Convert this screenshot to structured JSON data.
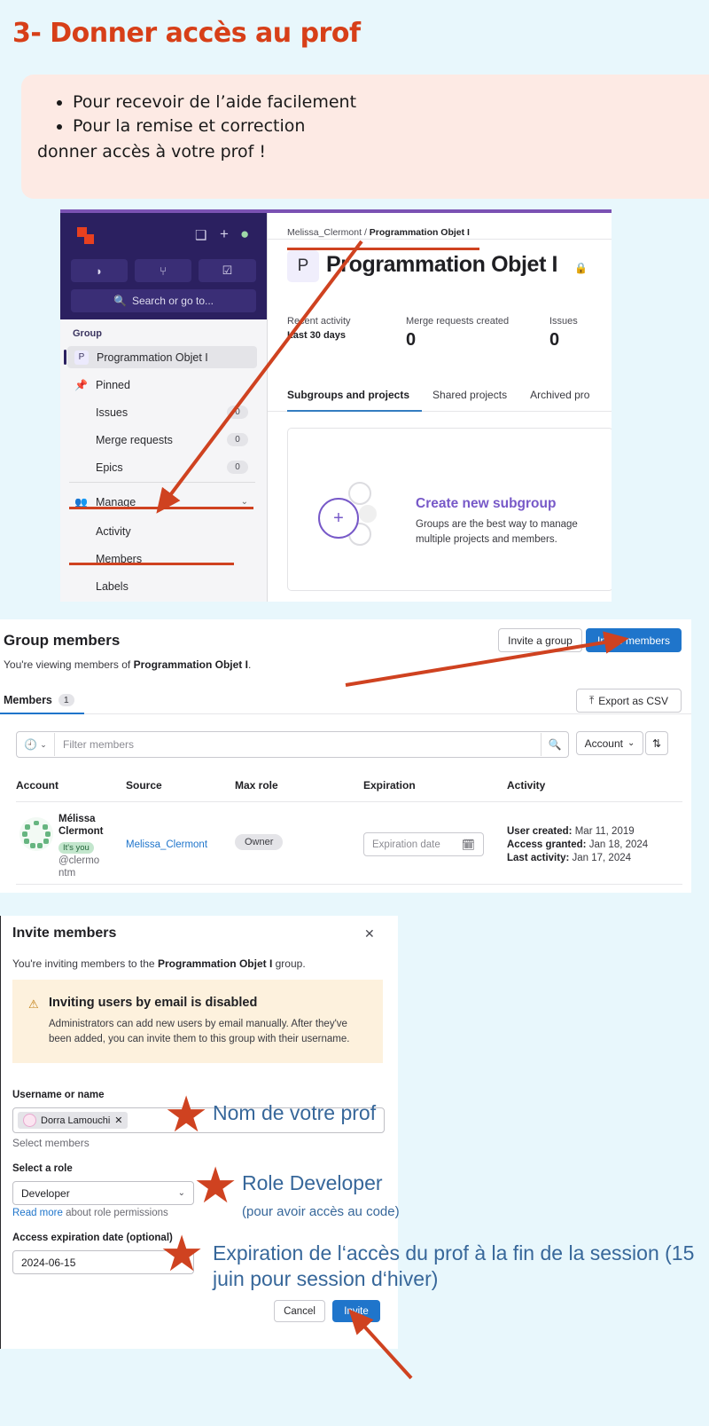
{
  "slide": {
    "title": "3- Donner accès au prof",
    "bullets": [
      "Pour recevoir de l’aide facilement",
      "Pour la remise et correction"
    ],
    "tail": "donner accès à votre prof !"
  },
  "colors": {
    "page_bg": "#e8f7fc",
    "title_orange": "#d73f18",
    "card_pink": "#fdeae4",
    "annotation_blue": "#37679a",
    "arrow_red": "#cf4220",
    "gitlab_purple": "#2b2060",
    "link_blue": "#1f75cb"
  },
  "gitlab_group_page": {
    "nav": {
      "logo": "gitlab-logo-icon",
      "top_icons": [
        "sidebar-toggle-icon",
        "plus-icon",
        "avatar-icon"
      ],
      "quick_buttons": [
        "issues-icon",
        "merge-request-icon",
        "todo-icon"
      ],
      "search_placeholder": "Search or go to...",
      "section_label": "Group",
      "items": [
        {
          "label": "Programmation Objet I",
          "badge": "P",
          "selected": true
        },
        {
          "label": "Pinned",
          "icon": "pin-icon"
        },
        {
          "label": "Issues",
          "count": "0"
        },
        {
          "label": "Merge requests",
          "count": "0"
        },
        {
          "label": "Epics",
          "count": "0"
        },
        {
          "label": "Manage",
          "icon": "users-icon",
          "chevron": "⌄"
        },
        {
          "label": "Activity"
        },
        {
          "label": "Members"
        },
        {
          "label": "Labels"
        }
      ]
    },
    "breadcrumb": {
      "owner": "Melissa_Clermont",
      "sep": "/",
      "current": "Programmation Objet I"
    },
    "project_badge": "P",
    "project_title": "Programmation Objet I",
    "lock_icon": "lock-icon",
    "stats": [
      {
        "label": "Recent activity",
        "value": "Last 30 days"
      },
      {
        "label": "Merge requests created",
        "value": "0"
      },
      {
        "label": "Issues",
        "value": "0"
      }
    ],
    "tabs": [
      "Subgroups and projects",
      "Shared projects",
      "Archived pro"
    ],
    "subgroup_card": {
      "title": "Create new subgroup",
      "description": "Groups are the best way to manage multiple projects and members.",
      "plus": "+"
    }
  },
  "group_members_page": {
    "title": "Group members",
    "subtitle_prefix": "You're viewing members of ",
    "subtitle_bold": "Programmation Objet I",
    "subtitle_suffix": ".",
    "invite_group_label": "Invite a group",
    "invite_members_label": "Invite members",
    "members_tab_label": "Members",
    "members_tab_count": "1",
    "export_label": "Export as CSV",
    "export_icon": "upload-icon",
    "filter": {
      "history_icon": "history-icon",
      "placeholder": "Filter members",
      "search_icon": "search-icon"
    },
    "sort_by": "Account",
    "sort_dir_icon": "sort-ascending-icon",
    "columns": [
      "Account",
      "Source",
      "Max role",
      "Expiration",
      "Activity"
    ],
    "row": {
      "avatar": "identicon-avatar",
      "name": "Mélissa Clermont",
      "you_badge": "It's you",
      "handle": "@clermontm",
      "source": "Melissa_Clermont",
      "max_role": "Owner",
      "expiration_placeholder": "Expiration date",
      "calendar_icon": "calendar-icon",
      "activity": [
        {
          "label": "User created:",
          "value": "Mar 11, 2019"
        },
        {
          "label": "Access granted:",
          "value": "Jan 18, 2024"
        },
        {
          "label": "Last activity:",
          "value": "Jan 17, 2024"
        }
      ]
    }
  },
  "invite_modal": {
    "title": "Invite members",
    "close_icon": "close-icon",
    "subtitle_prefix": "You're inviting members to the ",
    "subtitle_bold": "Programmation Objet I",
    "subtitle_suffix": " group.",
    "alert": {
      "icon": "warning-icon",
      "title": "Inviting users by email is disabled",
      "body": "Administrators can add new users by email manually. After they've been added, you can invite them to this group with their username."
    },
    "username_label": "Username or name",
    "token_name": "Dorra Lamouchi",
    "token_remove_icon": "close-icon",
    "select_members_hint": "Select members",
    "role_label": "Select a role",
    "role_value": "Developer",
    "role_chevron_icon": "chevron-down-icon",
    "read_more_link": "Read more",
    "read_more_rest": " about role permissions",
    "expiration_label": "Access expiration date (optional)",
    "expiration_value": "2024-06-15",
    "cancel_label": "Cancel",
    "invite_label": "Invite"
  },
  "annotations": {
    "star_icon": "star-icon",
    "note_name": "Nom de votre prof",
    "note_role": "Role Developer",
    "note_role_sub": "(pour avoir accès au code)",
    "note_expiration": "Expiration de l‘accès du prof à la fin de la session (15 juin pour session d‘hiver)"
  }
}
